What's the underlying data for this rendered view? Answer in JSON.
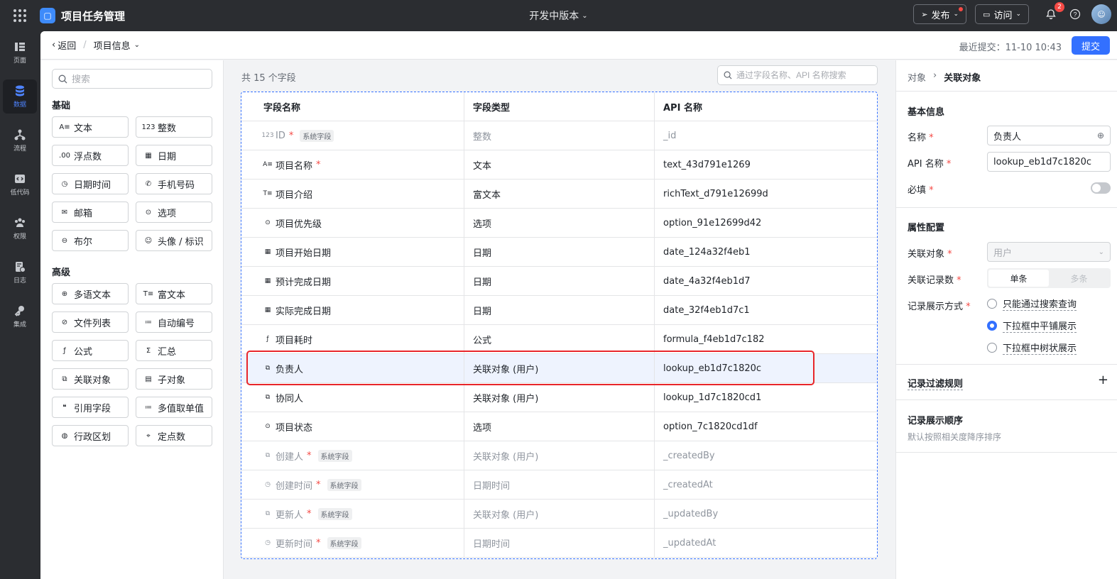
{
  "app": {
    "name": "项目任务管理",
    "version": "开发中版本"
  },
  "topbar": {
    "publish": "发布",
    "visit": "访问",
    "notif_count": "2"
  },
  "nav": [
    {
      "label": "页面",
      "icon": "pages-icon"
    },
    {
      "label": "数据",
      "icon": "database-icon"
    },
    {
      "label": "流程",
      "icon": "workflow-icon"
    },
    {
      "label": "低代码",
      "icon": "code-icon"
    },
    {
      "label": "权限",
      "icon": "users-icon"
    },
    {
      "label": "日志",
      "icon": "log-icon"
    },
    {
      "label": "集成",
      "icon": "key-icon"
    }
  ],
  "subhead": {
    "back": "返回",
    "crumb": "项目信息",
    "last_submit": "最近提交：11-10 10:43",
    "submit": "提交"
  },
  "fieldpanel": {
    "search_placeholder": "搜索",
    "basic_title": "基础",
    "basic": [
      {
        "icon": "A≡",
        "label": "文本"
      },
      {
        "icon": "123",
        "label": "整数"
      },
      {
        "icon": ".00",
        "label": "浮点数"
      },
      {
        "icon": "▦",
        "label": "日期"
      },
      {
        "icon": "◷",
        "label": "日期时间"
      },
      {
        "icon": "✆",
        "label": "手机号码"
      },
      {
        "icon": "✉",
        "label": "邮箱"
      },
      {
        "icon": "⊙",
        "label": "选项"
      },
      {
        "icon": "⊖",
        "label": "布尔"
      },
      {
        "icon": "☺",
        "label": "头像 / 标识"
      }
    ],
    "advanced_title": "高级",
    "advanced": [
      {
        "icon": "⊕",
        "label": "多语文本"
      },
      {
        "icon": "T≡",
        "label": "富文本"
      },
      {
        "icon": "⊘",
        "label": "文件列表"
      },
      {
        "icon": "≔",
        "label": "自动编号"
      },
      {
        "icon": "ƒ",
        "label": "公式"
      },
      {
        "icon": "Σ",
        "label": "汇总"
      },
      {
        "icon": "⧉",
        "label": "关联对象"
      },
      {
        "icon": "▤",
        "label": "子对象"
      },
      {
        "icon": "❝",
        "label": "引用字段"
      },
      {
        "icon": "≔",
        "label": "多值取单值"
      },
      {
        "icon": "◍",
        "label": "行政区划"
      },
      {
        "icon": "⌖",
        "label": "定点数"
      }
    ]
  },
  "table": {
    "count": "共 15 个字段",
    "search_placeholder": "通过字段名称、API 名称搜索",
    "headers": [
      "字段名称",
      "字段类型",
      "API 名称"
    ],
    "rows": [
      {
        "icon": "123",
        "name": "ID",
        "req": true,
        "tag": "系统字段",
        "type": "整数",
        "api": "_id",
        "sys": true
      },
      {
        "icon": "A≡",
        "name": "项目名称",
        "req": true,
        "tag": "",
        "type": "文本",
        "api": "text_43d791e1269",
        "sys": false
      },
      {
        "icon": "T≡",
        "name": "项目介绍",
        "req": false,
        "tag": "",
        "type": "富文本",
        "api": "richText_d791e12699d",
        "sys": false
      },
      {
        "icon": "⊙",
        "name": "项目优先级",
        "req": false,
        "tag": "",
        "type": "选项",
        "api": "option_91e12699d42",
        "sys": false
      },
      {
        "icon": "▦",
        "name": "项目开始日期",
        "req": false,
        "tag": "",
        "type": "日期",
        "api": "date_124a32f4eb1",
        "sys": false
      },
      {
        "icon": "▦",
        "name": "预计完成日期",
        "req": false,
        "tag": "",
        "type": "日期",
        "api": "date_4a32f4eb1d7",
        "sys": false
      },
      {
        "icon": "▦",
        "name": "实际完成日期",
        "req": false,
        "tag": "",
        "type": "日期",
        "api": "date_32f4eb1d7c1",
        "sys": false
      },
      {
        "icon": "ƒ",
        "name": "项目耗时",
        "req": false,
        "tag": "",
        "type": "公式",
        "api": "formula_f4eb1d7c182",
        "sys": false
      },
      {
        "icon": "⧉",
        "name": "负责人",
        "req": false,
        "tag": "",
        "type": "关联对象 (用户)",
        "api": "lookup_eb1d7c1820c",
        "sys": false,
        "selected": true
      },
      {
        "icon": "⧉",
        "name": "协同人",
        "req": false,
        "tag": "",
        "type": "关联对象 (用户)",
        "api": "lookup_1d7c1820cd1",
        "sys": false
      },
      {
        "icon": "⊙",
        "name": "项目状态",
        "req": false,
        "tag": "",
        "type": "选项",
        "api": "option_7c1820cd1df",
        "sys": false
      },
      {
        "icon": "⧉",
        "name": "创建人",
        "req": true,
        "tag": "系统字段",
        "type": "关联对象 (用户)",
        "api": "_createdBy",
        "sys": true
      },
      {
        "icon": "◷",
        "name": "创建时间",
        "req": true,
        "tag": "系统字段",
        "type": "日期时间",
        "api": "_createdAt",
        "sys": true
      },
      {
        "icon": "⧉",
        "name": "更新人",
        "req": true,
        "tag": "系统字段",
        "type": "关联对象 (用户)",
        "api": "_updatedBy",
        "sys": true
      },
      {
        "icon": "◷",
        "name": "更新时间",
        "req": true,
        "tag": "系统字段",
        "type": "日期时间",
        "api": "_updatedAt",
        "sys": true
      }
    ]
  },
  "rightpanel": {
    "crumb_root": "对象",
    "crumb_current": "关联对象",
    "basic_title": "基本信息",
    "name_label": "名称",
    "name_value": "负责人",
    "api_label": "API 名称",
    "api_value": "lookup_eb1d7c1820c",
    "required_label": "必填",
    "attr_title": "属性配置",
    "lookup_label": "关联对象",
    "lookup_value": "用户",
    "count_label": "关联记录数",
    "count_single": "单条",
    "count_multi": "多条",
    "display_label": "记录展示方式",
    "display_opts": [
      "只能通过搜索查询",
      "下拉框中平铺展示",
      "下拉框中树状展示"
    ],
    "filter_title": "记录过滤规则",
    "order_title": "记录展示顺序",
    "order_desc": "默认按照相关度降序排序"
  }
}
